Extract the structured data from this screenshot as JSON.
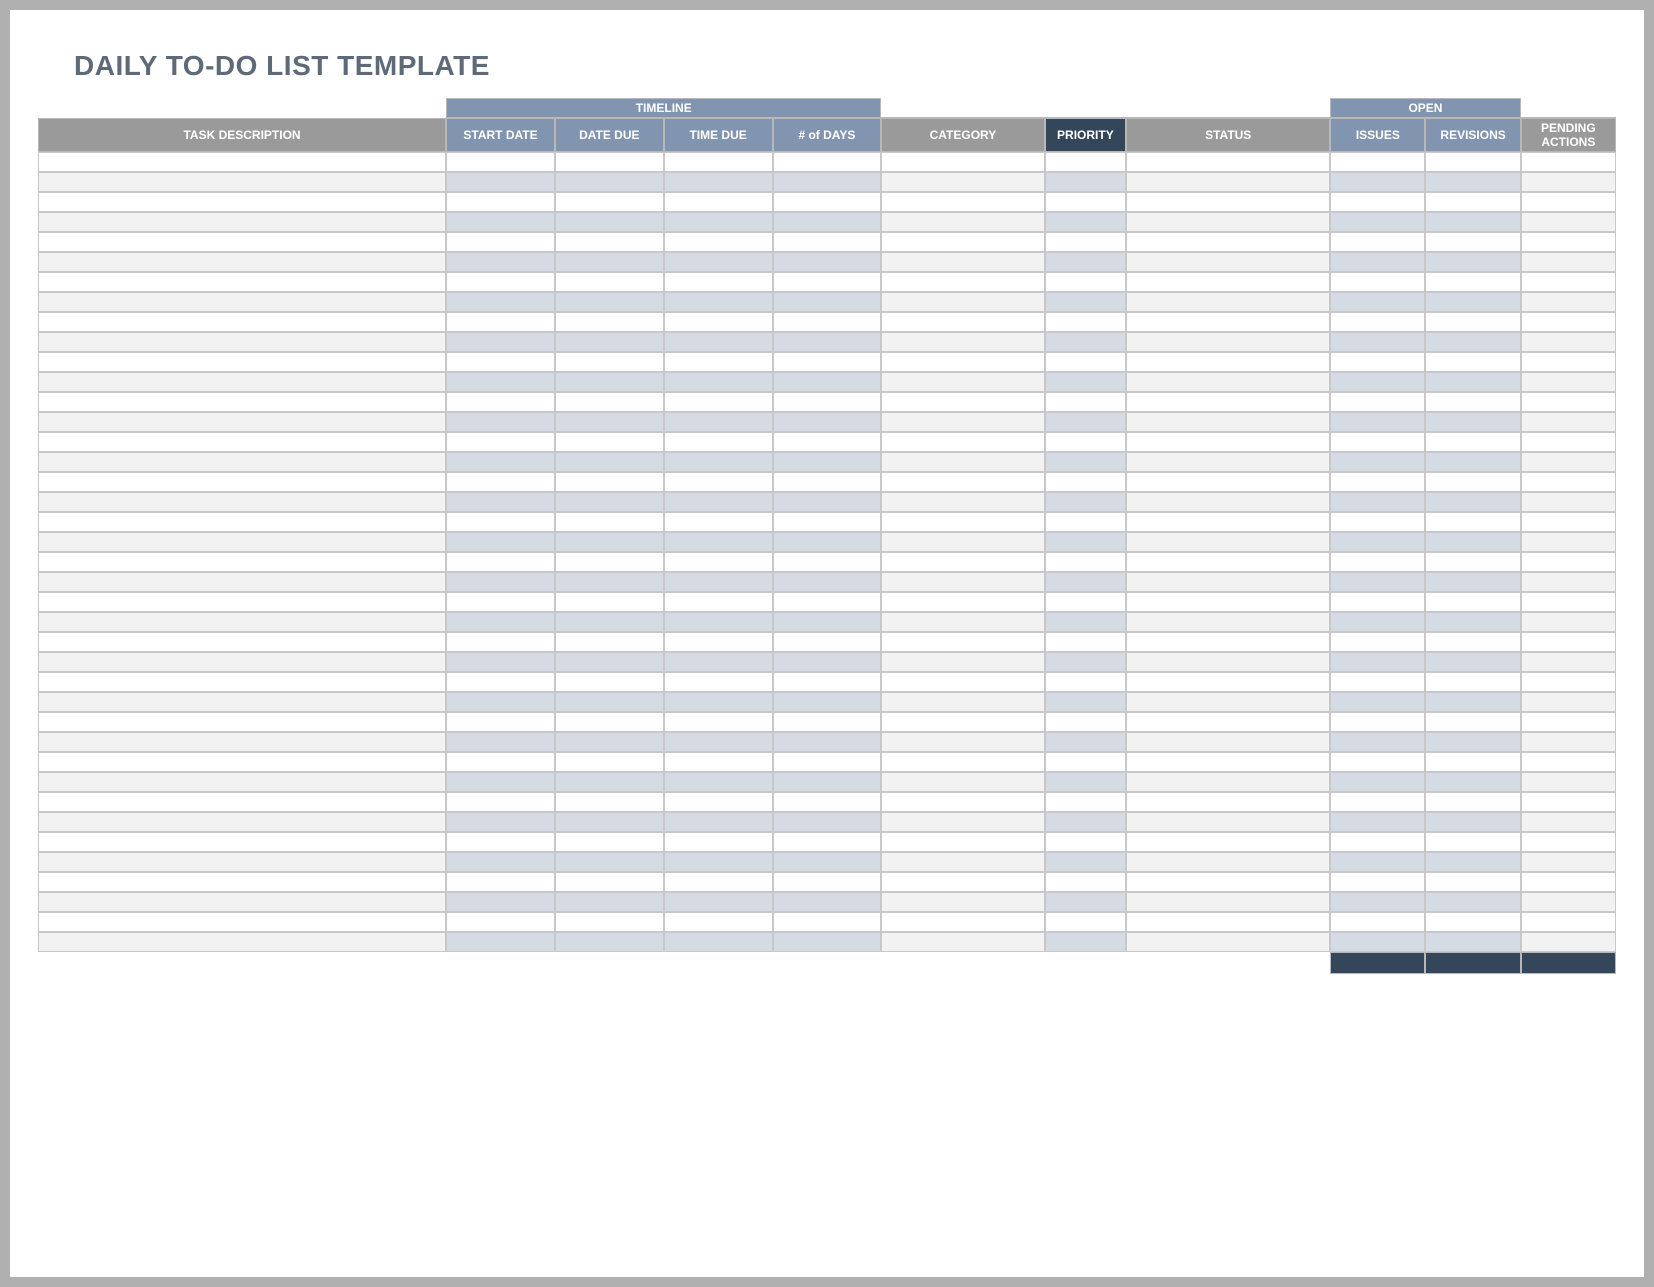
{
  "title": "DAILY TO-DO LIST TEMPLATE",
  "groupHeaders": {
    "timeline": "TIMELINE",
    "open": "OPEN"
  },
  "columns": {
    "task_description": "TASK DESCRIPTION",
    "start_date": "START DATE",
    "date_due": "DATE DUE",
    "time_due": "TIME DUE",
    "num_days": "# of DAYS",
    "category": "CATEGORY",
    "priority": "PRIORITY",
    "status": "STATUS",
    "issues": "ISSUES",
    "revisions": "REVISIONS",
    "pending_actions": "PENDING ACTIONS"
  },
  "rowCount": 40
}
